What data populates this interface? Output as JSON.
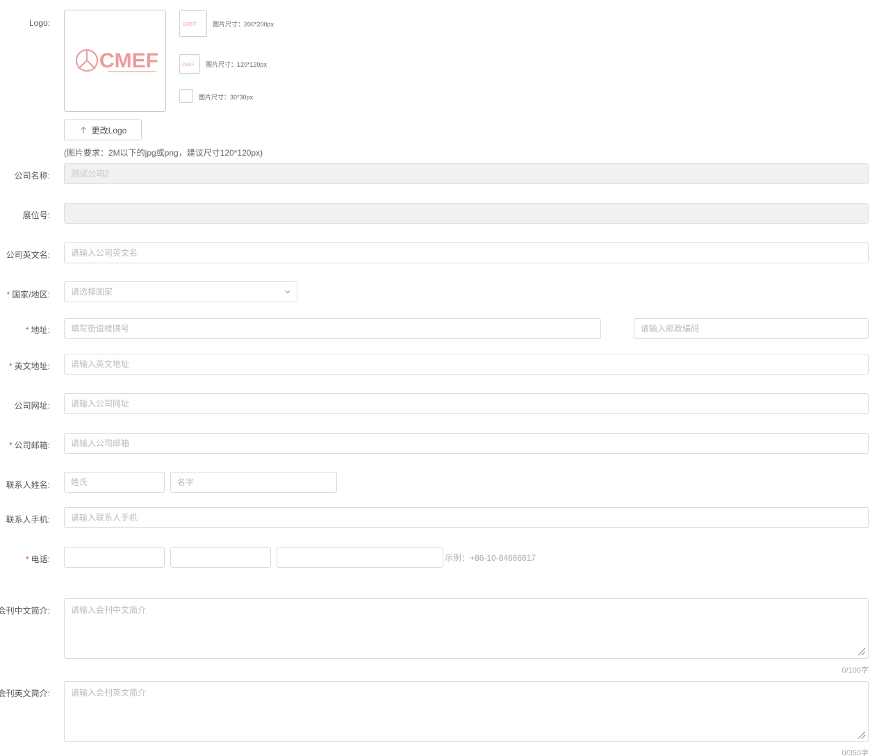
{
  "logo": {
    "label": "Logo:",
    "brand_text": "CMEF",
    "brand_color": "#e05252",
    "thumbnails": [
      {
        "size_text": "图片尺寸：200*200px"
      },
      {
        "size_text": "图片尺寸：120*120px"
      },
      {
        "size_text": "图片尺寸：30*30px"
      }
    ],
    "change_button": "更改Logo",
    "upload_icon": "upload-arrow-icon",
    "hint": "(图片要求：2M以下的jpg或png，建议尺寸120*120px)"
  },
  "fields": {
    "company_name": {
      "label": "公司名称:",
      "value": "测试公司2"
    },
    "booth_no": {
      "label": "展位号:",
      "value": ""
    },
    "company_en_name": {
      "label": "公司英文名:",
      "placeholder": "请输入公司英文名"
    },
    "country": {
      "label": "国家/地区:",
      "placeholder": "请选择国家",
      "required": true
    },
    "address": {
      "label": "地址:",
      "placeholder": "填写街道楼牌号",
      "postcode_placeholder": "请输入邮政编码",
      "required": true
    },
    "en_address": {
      "label": "英文地址:",
      "placeholder": "请输入英文地址",
      "required": true
    },
    "website": {
      "label": "公司网址:",
      "placeholder": "请输入公司网址"
    },
    "email": {
      "label": "公司邮箱:",
      "placeholder": "请输入公司邮箱",
      "required": true
    },
    "contact_name": {
      "label": "联系人姓名:",
      "last_name_placeholder": "姓氏",
      "first_name_placeholder": "名字"
    },
    "contact_mobile": {
      "label": "联系人手机:",
      "placeholder": "请输入联系人手机"
    },
    "phone": {
      "label": "电话:",
      "example": "示例：+86-10-84666617",
      "required": true
    },
    "cn_intro": {
      "label": "会刊中文简介:",
      "placeholder": "请输入会刊中文简介",
      "counter": "0/100字"
    },
    "en_intro": {
      "label": "会刊英文简介:",
      "placeholder": "请输入会刊英文简介",
      "counter": "0/350字"
    }
  },
  "colors": {
    "required_star": "#e54b4b",
    "disabled_bg": "#f1f1f1",
    "border": "#d9d9d9"
  }
}
